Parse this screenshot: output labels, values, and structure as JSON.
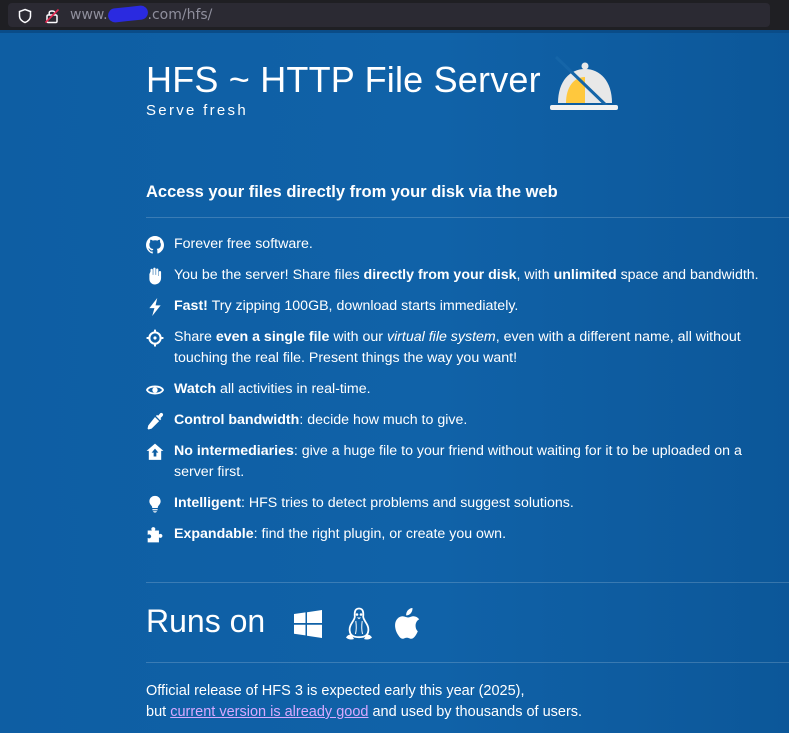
{
  "browser": {
    "url_prefix": "www.",
    "url_suffix": ".com/hfs/"
  },
  "header": {
    "title": "HFS ~ HTTP File Server",
    "subtitle": "Serve fresh",
    "logo_icon": "cloche-icon"
  },
  "tagline": "Access your files directly from your disk via the web",
  "features": [
    {
      "icon": "github-icon",
      "parts": [
        {
          "t": "Forever free software.",
          "s": "n"
        }
      ]
    },
    {
      "icon": "hand-icon",
      "parts": [
        {
          "t": "You be the server! Share files ",
          "s": "n"
        },
        {
          "t": "directly from your disk",
          "s": "b"
        },
        {
          "t": ", with ",
          "s": "n"
        },
        {
          "t": "unlimited",
          "s": "b"
        },
        {
          "t": " space and bandwidth.",
          "s": "n"
        }
      ]
    },
    {
      "icon": "lightning-icon",
      "parts": [
        {
          "t": "Fast!",
          "s": "b"
        },
        {
          "t": " Try zipping 100GB, download starts immediately.",
          "s": "n"
        }
      ]
    },
    {
      "icon": "crosshair-icon",
      "parts": [
        {
          "t": "Share ",
          "s": "n"
        },
        {
          "t": "even a single file",
          "s": "b"
        },
        {
          "t": " with our ",
          "s": "n"
        },
        {
          "t": "virtual file system",
          "s": "i"
        },
        {
          "t": ", even with a different name, all without touching the real file. Present things the way you want!",
          "s": "n"
        }
      ]
    },
    {
      "icon": "eye-icon",
      "parts": [
        {
          "t": "Watch",
          "s": "b"
        },
        {
          "t": " all activities in real-time.",
          "s": "n"
        }
      ]
    },
    {
      "icon": "eyedropper-icon",
      "parts": [
        {
          "t": "Control bandwidth",
          "s": "b"
        },
        {
          "t": ": decide how much to give.",
          "s": "n"
        }
      ]
    },
    {
      "icon": "house-up-icon",
      "parts": [
        {
          "t": "No intermediaries",
          "s": "b"
        },
        {
          "t": ": give a huge file to your friend without waiting for it to be uploaded on a server first.",
          "s": "n"
        }
      ]
    },
    {
      "icon": "lightbulb-icon",
      "parts": [
        {
          "t": "Intelligent",
          "s": "b"
        },
        {
          "t": ": HFS tries to detect problems and suggest solutions.",
          "s": "n"
        }
      ]
    },
    {
      "icon": "puzzle-icon",
      "parts": [
        {
          "t": "Expandable",
          "s": "b"
        },
        {
          "t": ": find the right plugin, or create you own.",
          "s": "n"
        }
      ]
    }
  ],
  "runs_on": {
    "label": "Runs on",
    "platforms": [
      "windows-icon",
      "linux-icon",
      "apple-icon"
    ]
  },
  "release": {
    "line1": "Official release of HFS 3 is expected early this year (2025),",
    "before_link": "but ",
    "link_text": "current version is already good",
    "after_link": " and used by thousands of users."
  },
  "colors": {
    "background": "#0e5a9b",
    "link": "#d7a9ff",
    "logo_bell": "#ffc83d"
  }
}
